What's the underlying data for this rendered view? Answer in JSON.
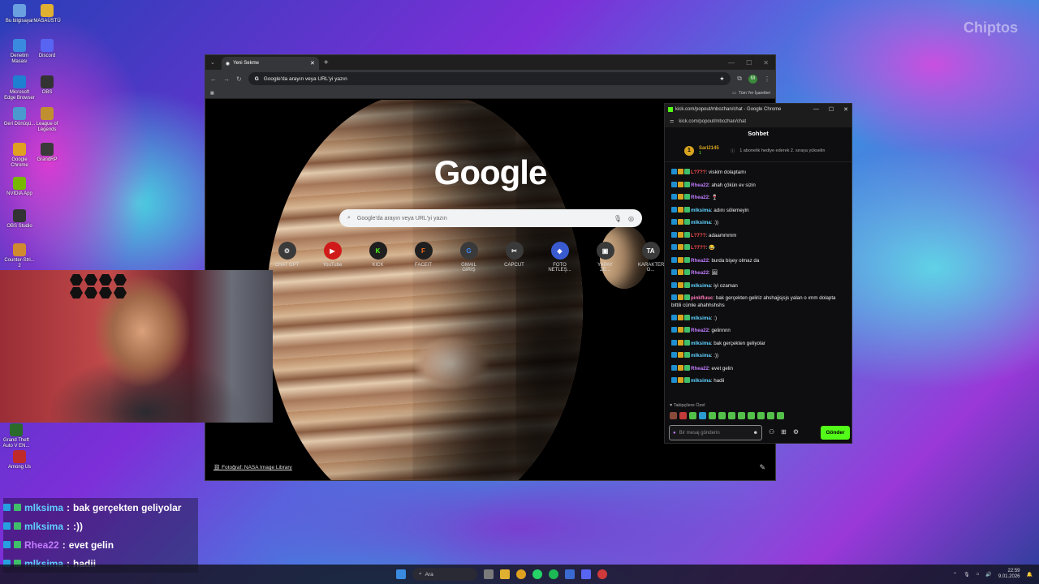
{
  "watermark": "Chiptos",
  "desktop": {
    "icons": [
      {
        "label": "Bu bilgisayar"
      },
      {
        "label": "MASAÜSTÜ"
      },
      {
        "label": "Denetim Masası"
      },
      {
        "label": "Discord"
      },
      {
        "label": "Microsoft Edge Browser"
      },
      {
        "label": "OBS"
      },
      {
        "label": "Geri Dönüşü..."
      },
      {
        "label": "League of Legends"
      },
      {
        "label": "Google Chrome"
      },
      {
        "label": "GrandRP"
      },
      {
        "label": "NVIDIA App"
      },
      {
        "label": "OBS Studio"
      },
      {
        "label": "Counter-Stri... 2"
      },
      {
        "label": "Grand Theft Auto V EN..."
      },
      {
        "label": "Among Us"
      }
    ]
  },
  "chrome": {
    "tab_title": "Yeni Sekme",
    "omnibox": "Google'da arayın veya URL'yi yazın",
    "bookmarks_label": "Tüm Yer İşaretleri",
    "profile_initial": "M",
    "logo": "Google",
    "search_placeholder": "Google'da arayın veya URL'yi yazın",
    "shortcuts": [
      {
        "label": "CHAT GPT",
        "glyph": "⚙"
      },
      {
        "label": "YouTube",
        "glyph": "▶"
      },
      {
        "label": "KICK",
        "glyph": "K"
      },
      {
        "label": "FACEIT",
        "glyph": "F"
      },
      {
        "label": "GMAIL GİRİŞ",
        "glyph": "G"
      },
      {
        "label": "CAPCUT",
        "glyph": "✂"
      },
      {
        "label": "FOTO NETLEŞ...",
        "glyph": "◆"
      },
      {
        "label": "YAPAY ZE...",
        "glyph": "▣"
      },
      {
        "label": "KARAKTER O...",
        "glyph": "TA"
      }
    ],
    "photo_credit": "Fotoğraf: NASA Image Library"
  },
  "kick": {
    "window_title": "kick.com/popout/mbozhan/chat - Google Chrome",
    "url": "kick.com/popout/mbozhan/chat",
    "header": "Sohbet",
    "pinned": {
      "rank": "1",
      "user": "Sari2145",
      "sub": "1",
      "text": "1 abonelik hediye ederek 2. sıraya yükselin"
    },
    "messages": [
      {
        "user": "L?7??",
        "color": "#ff4d4d",
        "text": "viskim dolaptamı"
      },
      {
        "user": "Rhea22",
        "color": "#c27cff",
        "text": "ahah çökün ev sizin"
      },
      {
        "user": "Rhea22",
        "color": "#c27cff",
        "text": "🍷"
      },
      {
        "user": "mlksima",
        "color": "#5fd2ff",
        "text": "adını sölemeyin"
      },
      {
        "user": "mlksima",
        "color": "#5fd2ff",
        "text": ":))"
      },
      {
        "user": "L?7??",
        "color": "#ff4d4d",
        "text": "adaammmm"
      },
      {
        "user": "L?7??",
        "color": "#ff4d4d",
        "text": "😂"
      },
      {
        "user": "Rhea22",
        "color": "#c27cff",
        "text": "burda bişey olmaz da"
      },
      {
        "user": "Rhea22",
        "color": "#c27cff",
        "text": "🖼"
      },
      {
        "user": "mlksima",
        "color": "#5fd2ff",
        "text": "iyi ozaman"
      },
      {
        "user": "pinkfluuc",
        "color": "#ff7ab8",
        "text": "bak gerçekten geliriz ahshajjsjsjs yalan o ımm dolapta bittili cümle ahahhshshs"
      },
      {
        "user": "mlksima",
        "color": "#5fd2ff",
        "text": ":)"
      },
      {
        "user": "Rhea22",
        "color": "#c27cff",
        "text": "gelinnnn"
      },
      {
        "user": "mlksima",
        "color": "#5fd2ff",
        "text": "bak gerçekten geliyolar"
      },
      {
        "user": "mlksima",
        "color": "#5fd2ff",
        "text": ":))"
      },
      {
        "user": "Rhea22",
        "color": "#c27cff",
        "text": "evet gelin"
      },
      {
        "user": "mlksima",
        "color": "#5fd2ff",
        "text": "hadii"
      }
    ],
    "followers_only": "Takipçilere Özel",
    "input_placeholder": "Bir mesaj gönderin",
    "send_label": "Gönder"
  },
  "overlay": [
    {
      "user": "mlksima",
      "color": "#5fd2ff",
      "text": "bak gerçekten geliyolar"
    },
    {
      "user": "mlksima",
      "color": "#5fd2ff",
      "text": ":))"
    },
    {
      "user": "Rhea22",
      "color": "#c27cff",
      "text": "evet gelin"
    },
    {
      "user": "mlksima",
      "color": "#5fd2ff",
      "text": "hadii"
    }
  ],
  "taskbar": {
    "search": "Ara",
    "time": "22:59",
    "date": "9.01.2026"
  }
}
